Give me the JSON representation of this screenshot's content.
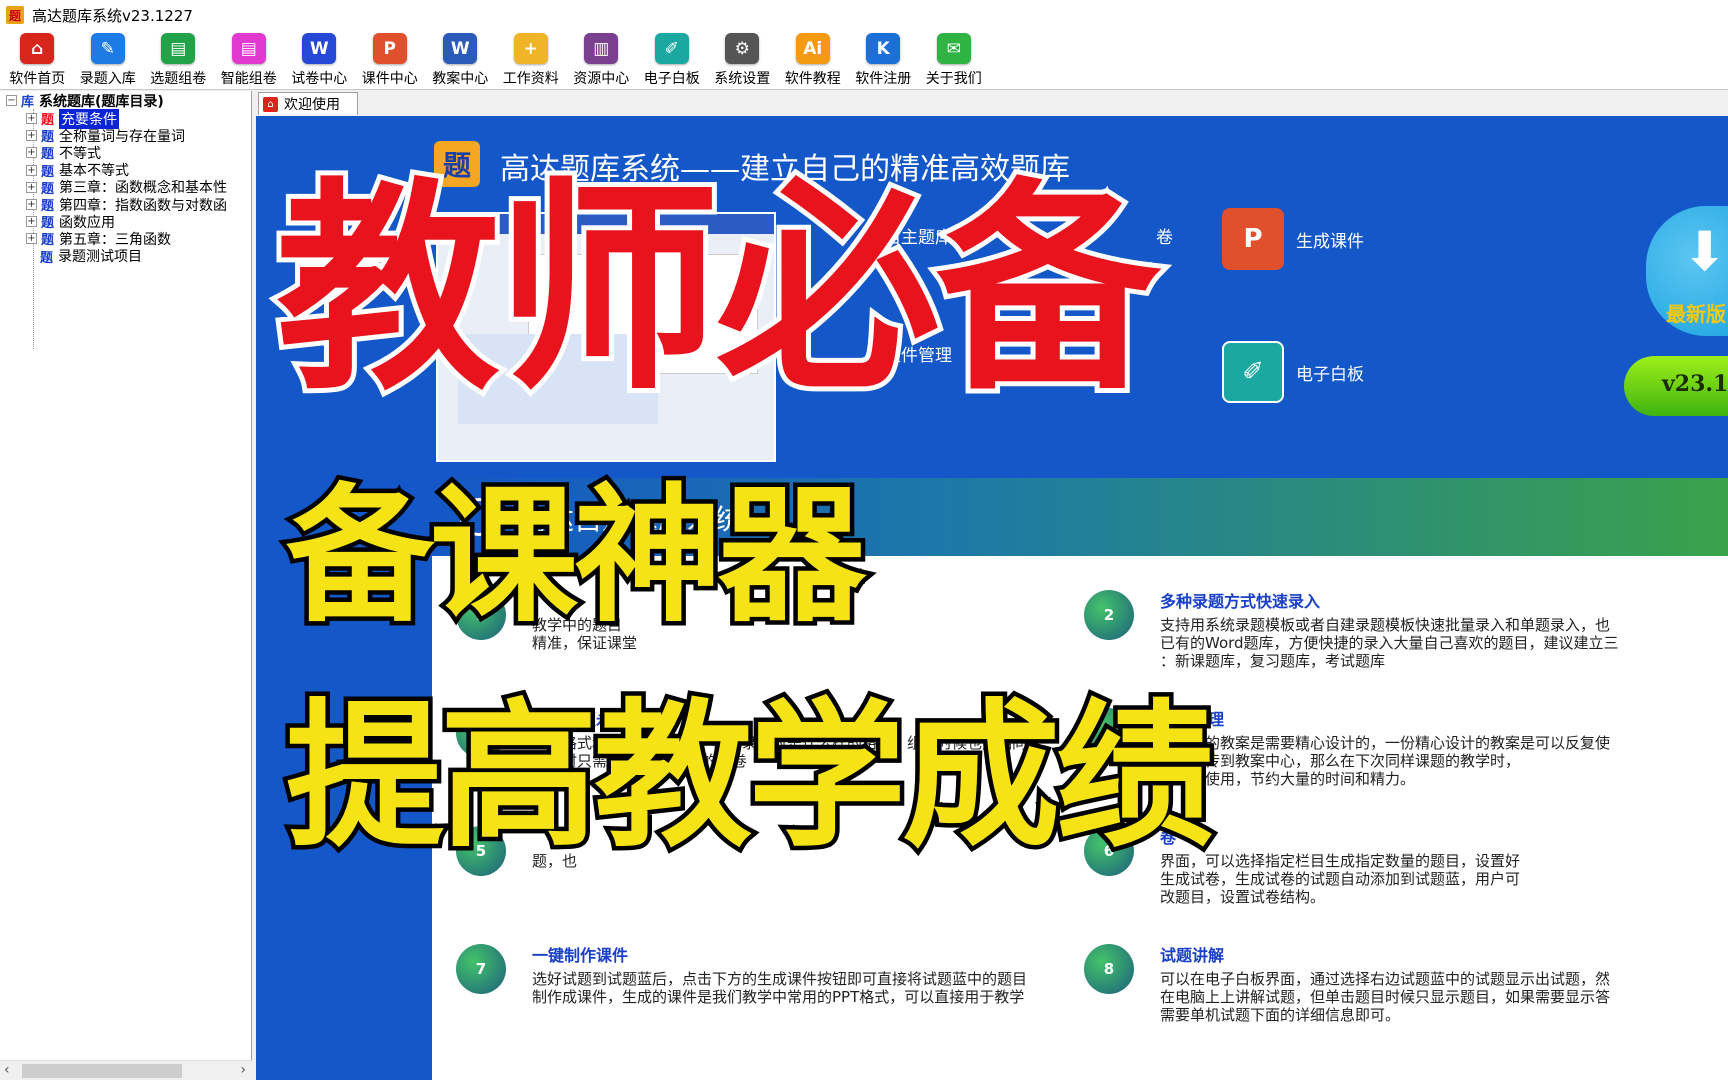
{
  "window": {
    "title": "高达题库系统v23.1227",
    "app_icon_glyph": "题"
  },
  "toolbar": [
    {
      "label": "软件首页",
      "icon": "home-icon",
      "color": "#d9261c",
      "glyph": "⌂"
    },
    {
      "label": "录题入库",
      "icon": "edit-doc-icon",
      "color": "#1e7be6",
      "glyph": "✎"
    },
    {
      "label": "选题组卷",
      "icon": "sheet-icon",
      "color": "#22a34a",
      "glyph": "▤"
    },
    {
      "label": "智能组卷",
      "icon": "smart-doc-icon",
      "color": "#e23ad0",
      "glyph": "▤"
    },
    {
      "label": "试卷中心",
      "icon": "word-w-icon",
      "color": "#2548d6",
      "glyph": "W"
    },
    {
      "label": "课件中心",
      "icon": "ppt-icon",
      "color": "#e1502d",
      "glyph": "P"
    },
    {
      "label": "教案中心",
      "icon": "word-doc-icon",
      "color": "#2b5bb8",
      "glyph": "W"
    },
    {
      "label": "工作资料",
      "icon": "folder-icon",
      "color": "#f0b428",
      "glyph": "+"
    },
    {
      "label": "资源中心",
      "icon": "books-icon",
      "color": "#7a3f8f",
      "glyph": "▥"
    },
    {
      "label": "电子白板",
      "icon": "whiteboard-icon",
      "color": "#1aa8a0",
      "glyph": "✐"
    },
    {
      "label": "系统设置",
      "icon": "gear-icon",
      "color": "#555555",
      "glyph": "⚙"
    },
    {
      "label": "软件教程",
      "icon": "ai-icon",
      "color": "#f39a12",
      "glyph": "Ai"
    },
    {
      "label": "软件注册",
      "icon": "key-icon",
      "color": "#1d6fd8",
      "glyph": "K"
    },
    {
      "label": "关于我们",
      "icon": "wechat-icon",
      "color": "#2fb343",
      "glyph": "✉"
    }
  ],
  "tree": {
    "root": {
      "badge": "库",
      "label": "系统题库(题库目录)"
    },
    "items": [
      {
        "badge": "题",
        "label": "充要条件",
        "selected": true,
        "badge_color": "#e8131c"
      },
      {
        "badge": "题",
        "label": "全称量词与存在量词",
        "badge_color": "#1a40c8"
      },
      {
        "badge": "题",
        "label": "不等式",
        "badge_color": "#1a40c8"
      },
      {
        "badge": "题",
        "label": "基本不等式",
        "badge_color": "#1a40c8"
      },
      {
        "badge": "题",
        "label": "第三章：函数概念和基本性",
        "badge_color": "#1a40c8"
      },
      {
        "badge": "题",
        "label": "第四章：指数函数与对数函",
        "badge_color": "#1a40c8"
      },
      {
        "badge": "题",
        "label": "函数应用",
        "badge_color": "#1a40c8"
      },
      {
        "badge": "题",
        "label": "第五章：三角函数",
        "badge_color": "#1a40c8"
      },
      {
        "badge": "题",
        "label": "录题测试项目",
        "badge_color": "#1a40c8",
        "leaf": true
      }
    ]
  },
  "tab": {
    "label": "欢迎使用"
  },
  "welcome": {
    "logo_glyph": "题",
    "title": "高达题库系统——建立自己的精准高效题库",
    "shortcuts": [
      {
        "label": "自主题库",
        "icon": "self-bank-icon",
        "color": "#2e6fd4",
        "glyph": ""
      },
      {
        "label": "卷",
        "icon": "paper-icon",
        "color": "#2e6fd4",
        "glyph": ""
      },
      {
        "label": "生成课件",
        "icon": "ppt-icon",
        "color": "#e1502d",
        "glyph": "P"
      },
      {
        "label": "文件管理",
        "icon": "folder-icon",
        "color": "#f0b428",
        "glyph": ""
      },
      {
        "label": "电子白板",
        "icon": "whiteboard-icon",
        "color": "#1aa8a0",
        "glyph": "✐"
      }
    ],
    "update_label": "最新版",
    "version_label": "v23.1"
  },
  "panel": {
    "title": "高达自建题库系统",
    "features": [
      {
        "num": "1",
        "title": "",
        "desc": "教学中的题目\n精准，保证课堂"
      },
      {
        "num": "2",
        "title": "多种录题方式快速录入",
        "desc": "支持用系统录题模板或者自建录题模板快速批量录入和单题录入，也\n已有的Word题库，方便快捷的录入大量自己喜欢的题目，建议建立三\n：新课题库，复习题库，考试题库"
      },
      {
        "num": "3",
        "title": "一次排版永久使用",
        "desc": "录入格式和组卷格式完全一样，录入时是什么样的格式，组卷时候也是相同\n组卷时只需组卷即可 整齐的试卷"
      },
      {
        "num": "4",
        "title": "教案管理",
        "desc": "一份好的教案是需要精心设计的，一份精心设计的教案是可以反复使\n的教案传到教案中心，那么在下次同样课题的教学时，\n的教案使用，节约大量的时间和精力。"
      },
      {
        "num": "5",
        "title": "",
        "desc": "题，也"
      },
      {
        "num": "6",
        "title": "卷",
        "desc": "界面，可以选择指定栏目生成指定数量的题目，设置好\n生成试卷，生成试卷的试题自动添加到试题蓝，用户可\n改题目，设置试卷结构。"
      },
      {
        "num": "7",
        "title": "一键制作课件",
        "desc": "选好试题到试题蓝后，点击下方的生成课件按钮即可直接将试题蓝中的题目\n制作成课件，生成的课件是我们教学中常用的PPT格式，可以直接用于教学"
      },
      {
        "num": "8",
        "title": "试题讲解",
        "desc": "可以在电子白板界面，通过选择右边试题蓝中的试题显示出试题，然\n在电脑上上讲解试题，但单击题目时候只显示题目，如果需要显示答\n需要单机试题下面的详细信息即可。"
      }
    ]
  },
  "overlay": {
    "line1": "教师必备",
    "line2": "备课神器",
    "line3": "提高教学成绩"
  }
}
